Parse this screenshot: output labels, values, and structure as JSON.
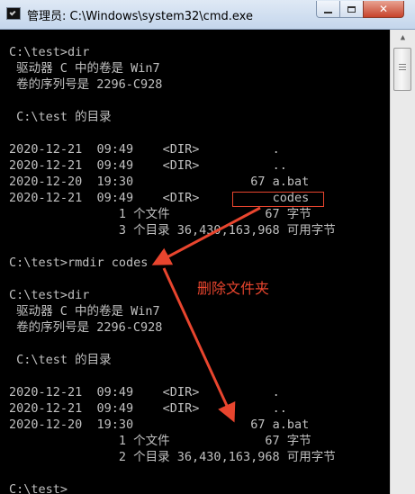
{
  "window": {
    "title": "管理员: C:\\Windows\\system32\\cmd.exe",
    "minimize_icon": "minimize-icon",
    "maximize_icon": "maximize-icon",
    "close_symbol": "✕"
  },
  "console": {
    "lines": [
      "C:\\test>dir",
      " 驱动器 C 中的卷是 Win7",
      " 卷的序列号是 2296-C928",
      "",
      " C:\\test 的目录",
      "",
      "2020-12-21  09:49    <DIR>          .",
      "2020-12-21  09:49    <DIR>          ..",
      "2020-12-20  19:30                67 a.bat",
      "2020-12-21  09:49    <DIR>          codes",
      "               1 个文件             67 字节",
      "               3 个目录 36,430,163,968 可用字节",
      "",
      "C:\\test>rmdir codes",
      "",
      "C:\\test>dir",
      " 驱动器 C 中的卷是 Win7",
      " 卷的序列号是 2296-C928",
      "",
      " C:\\test 的目录",
      "",
      "2020-12-21  09:49    <DIR>          .",
      "2020-12-21  09:49    <DIR>          ..",
      "2020-12-20  19:30                67 a.bat",
      "               1 个文件             67 字节",
      "               2 个目录 36,430,163,968 可用字节",
      "",
      "C:\\test>"
    ]
  },
  "annotation": {
    "label": "删除文件夹",
    "color": "#e8452e"
  },
  "scrollbar": {
    "up_arrow": "▲"
  }
}
